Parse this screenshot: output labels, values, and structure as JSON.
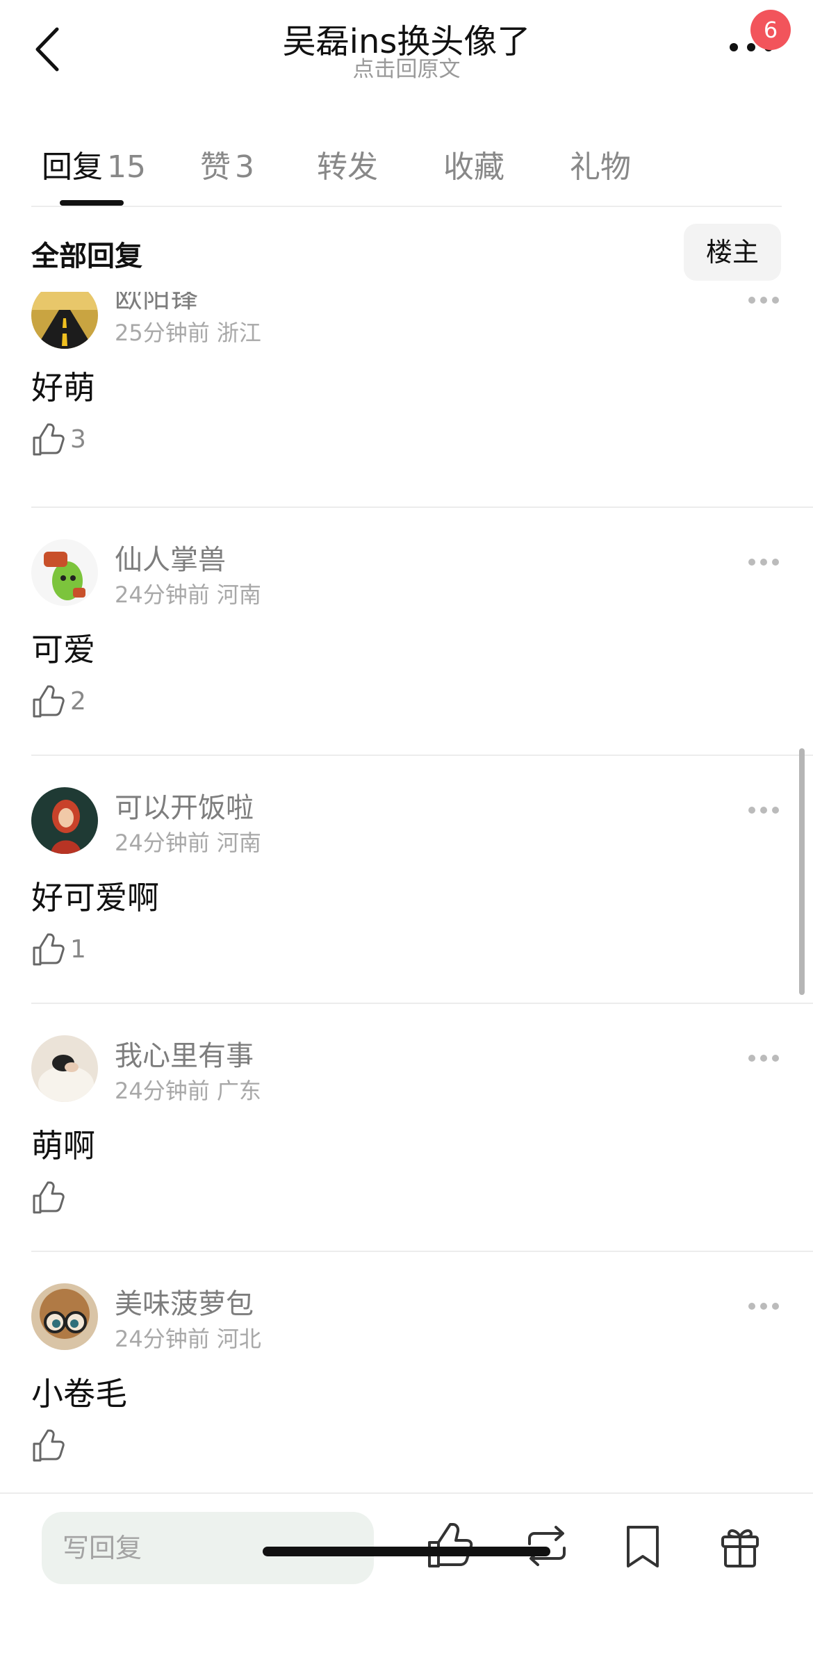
{
  "header": {
    "title": "吴磊ins换头像了",
    "subtitle": "点击回原文",
    "notification_count": "6"
  },
  "tabs": [
    {
      "label": "回复",
      "count": "15",
      "active": true
    },
    {
      "label": "赞",
      "count": "3",
      "active": false
    },
    {
      "label": "转发",
      "count": "",
      "active": false
    },
    {
      "label": "收藏",
      "count": "",
      "active": false
    },
    {
      "label": "礼物",
      "count": "",
      "active": false
    }
  ],
  "filter": {
    "label": "全部回复",
    "button": "楼主"
  },
  "comments": [
    {
      "username": "欧阳锋",
      "meta": "25分钟前 浙江",
      "text": "好萌",
      "likes": "3",
      "avatar_icon": "road-avatar"
    },
    {
      "username": "仙人掌兽",
      "meta": "24分钟前 河南",
      "text": "可爱",
      "likes": "2",
      "avatar_icon": "cactus-avatar"
    },
    {
      "username": "可以开饭啦",
      "meta": "24分钟前 河南",
      "text": "好可爱啊",
      "likes": "1",
      "avatar_icon": "red-hair-avatar"
    },
    {
      "username": "我心里有事",
      "meta": "24分钟前 广东",
      "text": "萌啊",
      "likes": "",
      "avatar_icon": "sleeping-avatar"
    },
    {
      "username": "美味菠萝包",
      "meta": "24分钟前 河北",
      "text": "小卷毛",
      "likes": "",
      "avatar_icon": "glasses-avatar"
    }
  ],
  "bottom_bar": {
    "reply_placeholder": "写回复"
  },
  "colors": {
    "badge": "#f2545b",
    "input_bg": "#edf2ee",
    "muted_text": "#a8a8a8"
  }
}
